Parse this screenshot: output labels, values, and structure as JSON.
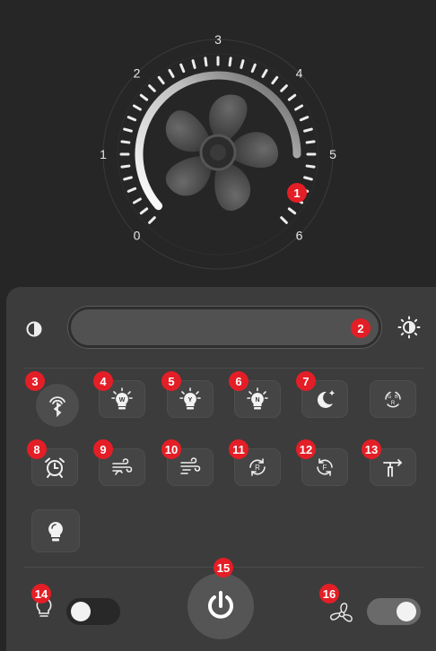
{
  "dial": {
    "scale_labels": [
      "0",
      "1",
      "2",
      "3",
      "4",
      "5",
      "6"
    ],
    "speed_level": 5
  },
  "badges": [
    "1",
    "2",
    "3",
    "4",
    "5",
    "6",
    "7",
    "8",
    "9",
    "10",
    "11",
    "12",
    "13",
    "14",
    "15",
    "16"
  ],
  "light_toggle": {
    "on": false
  },
  "fan_toggle": {
    "on": true
  },
  "icons": {
    "brightness_low": "contrast-icon",
    "brightness_high": "sun-icon",
    "row1": [
      "bluetooth-pair-icon",
      "bulb-white-icon",
      "bulb-yellow-icon",
      "bulb-neutral-icon",
      "moon-icon",
      "rgb-cycle-icon"
    ],
    "row2": [
      "alarm-icon",
      "breeze-icon",
      "natural-wind-icon",
      "reverse-icon",
      "forward-icon",
      "ceiling-fan-icon"
    ],
    "row3": [
      "bulb-icon"
    ],
    "bulb_letters": [
      "W",
      "Y",
      "N"
    ],
    "rotate_letters": [
      "R",
      "F"
    ],
    "rgb_letters": [
      "G",
      "B",
      "R"
    ]
  },
  "colors": {
    "badge": "#e41e26",
    "panel": "#3c3c3c",
    "background": "#262626"
  }
}
